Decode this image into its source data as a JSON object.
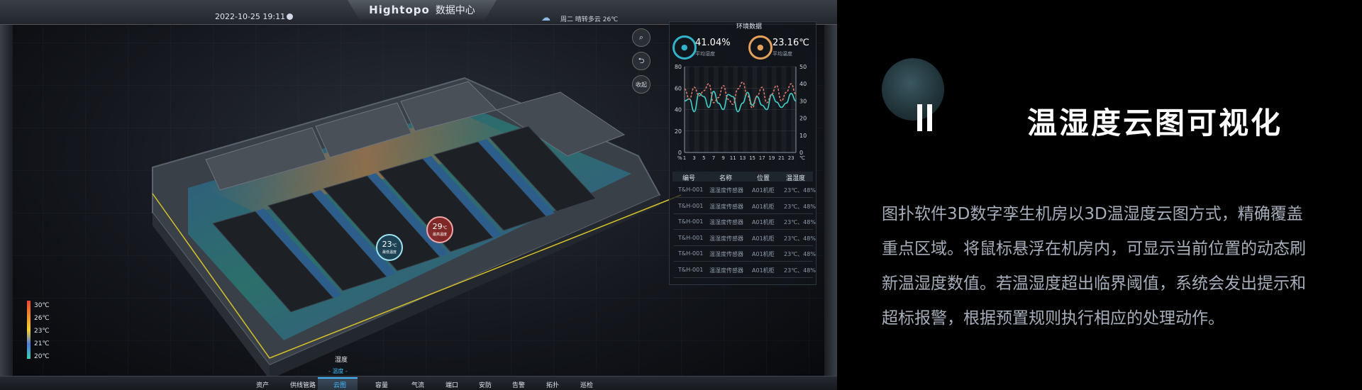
{
  "dashboard": {
    "brand_en": "Hightopo",
    "brand_cn": "数据中心",
    "datetime": "2022-10-25 19:11",
    "weather": "周二  晴转多云 26℃"
  },
  "tools": {
    "search": "⌕",
    "back": "⮌",
    "collapse": "收起"
  },
  "env_panel": {
    "title": "环境数据",
    "humidity": {
      "value": "41.04%",
      "label": "平均湿度"
    },
    "temperature": {
      "value": "23.16℃",
      "label": "平均温度"
    }
  },
  "chart_data": {
    "type": "line",
    "x": [
      1,
      2,
      3,
      4,
      5,
      6,
      7,
      8,
      9,
      10,
      11,
      12,
      13,
      14,
      15,
      16,
      17,
      18,
      19,
      20,
      21,
      22,
      23,
      24
    ],
    "x_tick_labels": [
      "1",
      "3",
      "5",
      "7",
      "9",
      "11",
      "13",
      "15",
      "17",
      "19",
      "21",
      "23"
    ],
    "x_unit": "℃",
    "y_left_unit": "%",
    "y_left": [
      0,
      20,
      40,
      60,
      80
    ],
    "y_right": [
      0,
      10,
      20,
      30,
      40,
      50
    ],
    "ylim_left": [
      0,
      80
    ],
    "ylim_right": [
      0,
      50
    ],
    "series": [
      {
        "axis": "left",
        "color": "#3fd0c8",
        "values": [
          48,
          50,
          38,
          55,
          52,
          42,
          57,
          46,
          40,
          54,
          52,
          38,
          46,
          56,
          44,
          52,
          44,
          40,
          54,
          47,
          42,
          46,
          55,
          48
        ]
      },
      {
        "axis": "right",
        "color": "#d97a6a",
        "values": [
          37,
          31,
          38,
          33,
          36,
          40,
          29,
          32,
          39,
          31,
          28,
          37,
          41,
          33,
          26,
          33,
          38,
          29,
          34,
          39,
          30,
          35,
          40,
          34
        ]
      }
    ]
  },
  "table": {
    "headers": [
      "编号",
      "名称",
      "位置",
      "温湿度"
    ],
    "rows": [
      [
        "T&H-001",
        "温湿度传感器",
        "A01机柜",
        "23℃、48%"
      ],
      [
        "T&H-001",
        "温湿度传感器",
        "A01机柜",
        "23℃、48%"
      ],
      [
        "T&H-001",
        "温湿度传感器",
        "A01机柜",
        "23℃、48%"
      ],
      [
        "T&H-001",
        "温湿度传感器",
        "A01机柜",
        "23℃、48%"
      ],
      [
        "T&H-001",
        "温湿度传感器",
        "A01机柜",
        "23℃、48%"
      ],
      [
        "T&H-001",
        "温湿度传感器",
        "A01机柜",
        "23℃、48%"
      ]
    ]
  },
  "markers": [
    {
      "value": "23",
      "unit": "℃",
      "label": "最低温度"
    },
    {
      "value": "29",
      "unit": "℃",
      "label": "最高温度"
    }
  ],
  "legend": [
    "30℃",
    "26℃",
    "23℃",
    "21℃",
    "20℃"
  ],
  "mode": {
    "humidity": "湿度",
    "temperature": "温度"
  },
  "nav": [
    "资产",
    "供线管路",
    "云图",
    "容量",
    "气流",
    "端口",
    "安防",
    "告警",
    "拓扑",
    "巡检"
  ],
  "feature": {
    "title": "温湿度云图可视化",
    "lines": [
      "图扑软件3D数字孪生机房以3D温湿度云图方式，精确覆盖",
      "重点区域。将鼠标悬浮在机房内，可显示当前位置的动态刷",
      "新温湿度数值。若温湿度超出临界阈值，系统会发出提示和",
      "超标报警，根据预置规则执行相应的处理动作。"
    ]
  }
}
